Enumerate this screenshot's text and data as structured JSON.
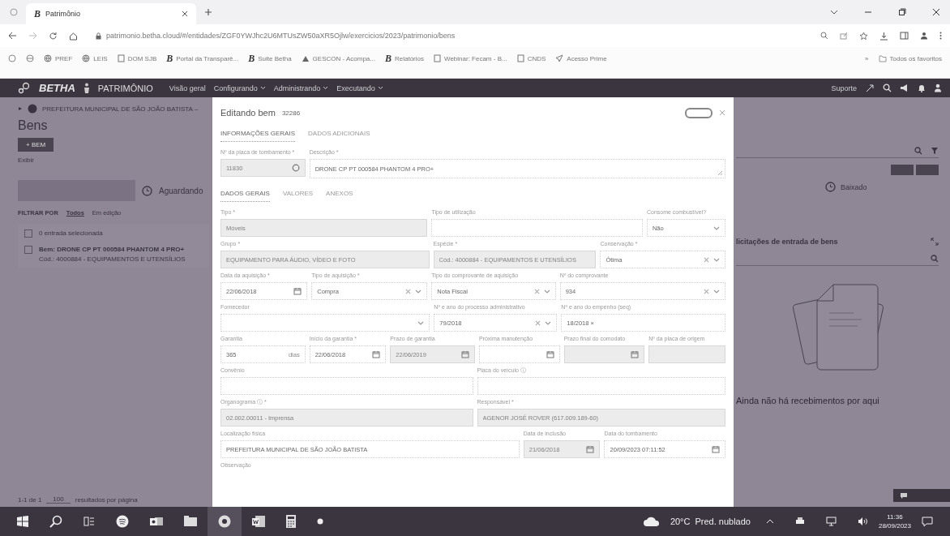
{
  "browser": {
    "tab": {
      "logo": "B",
      "title": "Patrimônio"
    },
    "url": "patrimonio.betha.cloud/#/entidades/ZGF0YWJhc2U6MTUsZW50aXR5Ojlw/exercicios/2023/patrimonio/bens",
    "bookmarks": [
      {
        "label": "PREF",
        "kind": "globe"
      },
      {
        "label": "LEIS",
        "kind": "globe"
      },
      {
        "label": "DOM SJB",
        "kind": "doc"
      },
      {
        "label": "Portal da Transparê...",
        "kind": "logo",
        "logo": "B"
      },
      {
        "label": "Suite Betha",
        "kind": "logo",
        "logo": "B"
      },
      {
        "label": "GESCON - Acompa...",
        "kind": "mountain"
      },
      {
        "label": "Relatórios",
        "kind": "logo",
        "logo": "B"
      },
      {
        "label": "Webinar: Fecam - B...",
        "kind": "doc"
      },
      {
        "label": "CNDS",
        "kind": "doc"
      },
      {
        "label": "Acesso Prime",
        "kind": "send"
      }
    ],
    "more": "»",
    "all_bookmarks": "Todos os favoritos"
  },
  "app_header": {
    "brand": "BETHA",
    "product": "PATRIMÔNIO",
    "menu": [
      {
        "label": "Visão geral",
        "dropdown": false
      },
      {
        "label": "Configurando",
        "dropdown": true
      },
      {
        "label": "Administrando",
        "dropdown": true
      },
      {
        "label": "Executando",
        "dropdown": true
      }
    ],
    "support": "Suporte"
  },
  "page": {
    "breadcrumb": "PREFEITURA MUNICIPAL DE SÃO JOÃO BATISTA –",
    "title": "Bens",
    "add_button": "+ BEM",
    "view_label": "Exibir",
    "waiting_label": "Aguardando",
    "filter_label": "FILTRAR POR",
    "filters": [
      {
        "label": "Todos",
        "selected": true
      },
      {
        "label": "Em edição",
        "selected": false
      }
    ],
    "selection": {
      "text": "0 entrada selecionada",
      "checked": false
    },
    "item": {
      "title": "Bem: DRONE CP PT 000584 PHANTOM 4 PRO+",
      "subtitle": "Cód.: 4000884 - EQUIPAMENTOS E UTENSÍLIOS",
      "checked": false
    },
    "pager_range": "1-1 de 1",
    "pager_size": "100",
    "pager_text": "resultados por página",
    "status_right": "Baixado",
    "panel_title": "licitações de entrada de bens",
    "empty_text": "Ainda não há recebimentos por aqui"
  },
  "modal": {
    "title": "Editando bem",
    "code": "32286",
    "tabs": [
      {
        "label": "INFORMAÇÕES GERAIS",
        "selected": true
      },
      {
        "label": "DADOS ADICIONAIS",
        "selected": false
      }
    ],
    "top_fields": [
      {
        "label": "Nº da placa de tombamento *",
        "value": "11830",
        "kind": "plate",
        "disabled": true
      },
      {
        "label": "Descrição *",
        "value": "DRONE CP PT 000584 PHANTOM 4 PRO+",
        "kind": "textarea",
        "disabled": false
      }
    ],
    "subtabs": [
      {
        "label": "DADOS GERAIS",
        "selected": true
      },
      {
        "label": "VALORES",
        "selected": false
      },
      {
        "label": "ANEXOS",
        "selected": false
      }
    ],
    "sections": [
      {
        "fields": [
          {
            "label": "Tipo *",
            "value": "Móveis",
            "kind": "text",
            "disabled": true
          },
          {
            "label": "Tipo de utilização",
            "kind": "text",
            "disabled": false
          },
          {
            "label": "Consome combustível?",
            "value": "Não",
            "kind": "select",
            "clearable": false,
            "disabled": false
          }
        ]
      },
      {
        "fields": [
          {
            "label": "Grupo *",
            "value": "EQUIPAMENTO PARA ÁUDIO, VÍDEO E FOTO",
            "kind": "text",
            "disabled": true
          },
          {
            "label": "Espécie *",
            "value": "Cód.: 4000884 - EQUIPAMENTOS E UTENSÍLIOS",
            "kind": "text",
            "disabled": true
          },
          {
            "label": "Conservação *",
            "value": "Ótima",
            "kind": "select",
            "clearable": true,
            "disabled": false
          }
        ]
      },
      {
        "fields": [
          {
            "label": "Data da aquisição *",
            "value": "22/06/2018",
            "kind": "date",
            "disabled": false
          },
          {
            "label": "Tipo de aquisição *",
            "value": "Compra",
            "kind": "select",
            "clearable": true,
            "disabled": false
          },
          {
            "label": "Tipo do comprovante de aquisição",
            "value": "Nota Fiscal",
            "kind": "select",
            "clearable": true,
            "disabled": false
          },
          {
            "label": "Nº do comprovante",
            "value": "934",
            "kind": "select",
            "clearable": true,
            "disabled": false
          }
        ]
      },
      {
        "fields": [
          {
            "label": "Fornecedor",
            "kind": "select",
            "clearable": false,
            "disabled": false
          },
          {
            "label": "Nº e ano do processo administrativo",
            "value": "79/2018",
            "kind": "select",
            "clearable": true,
            "disabled": false
          },
          {
            "label": "Nº e ano do empenho (seq)",
            "value": "18/2018 ×",
            "kind": "text",
            "disabled": false
          }
        ]
      },
      {
        "fields": [
          {
            "label": "Garantia",
            "value": "365",
            "suffix": "dias",
            "kind": "suffix",
            "disabled": false
          },
          {
            "label": "Início da garantia *",
            "value": "22/06/2018",
            "kind": "date",
            "disabled": false
          },
          {
            "label": "Prazo de garantia",
            "value": "22/06/2019",
            "kind": "date",
            "disabled": true
          },
          {
            "label": "Próxima manutenção",
            "kind": "date",
            "disabled": false
          },
          {
            "label": "Prazo final do comodato",
            "kind": "date",
            "disabled": true
          },
          {
            "label": "Nº da placa de origem",
            "kind": "text",
            "disabled": true
          }
        ]
      },
      {
        "fields": [
          {
            "label": "Convênio",
            "kind": "text",
            "disabled": false
          },
          {
            "label": "Placa do veículo ⓘ",
            "kind": "text",
            "disabled": false
          }
        ]
      },
      {
        "fields": [
          {
            "label": "Organograma ⓘ *",
            "value": "02.002.00011 - Imprensa",
            "kind": "text",
            "disabled": true
          },
          {
            "label": "Responsável *",
            "value": "AGENOR JOSÉ ROVER (617.009.189-60)",
            "kind": "text",
            "disabled": true
          }
        ]
      },
      {
        "fields": [
          {
            "label": "Localização física",
            "value": "PREFEITURA MUNICIPAL DE SÃO JOÃO BATISTA",
            "kind": "text",
            "disabled": false
          },
          {
            "label": "Data de inclusão",
            "value": "21/06/2018",
            "kind": "date",
            "disabled": true
          },
          {
            "label": "Data do tombamento",
            "value": "20/09/2023 07:11:52",
            "kind": "date",
            "disabled": false
          }
        ]
      }
    ],
    "last_label": "Observação"
  },
  "taskbar": {
    "temperature": "20°C",
    "weather": "Pred. nublado",
    "time": "11:36",
    "date": "28/09/2023"
  }
}
